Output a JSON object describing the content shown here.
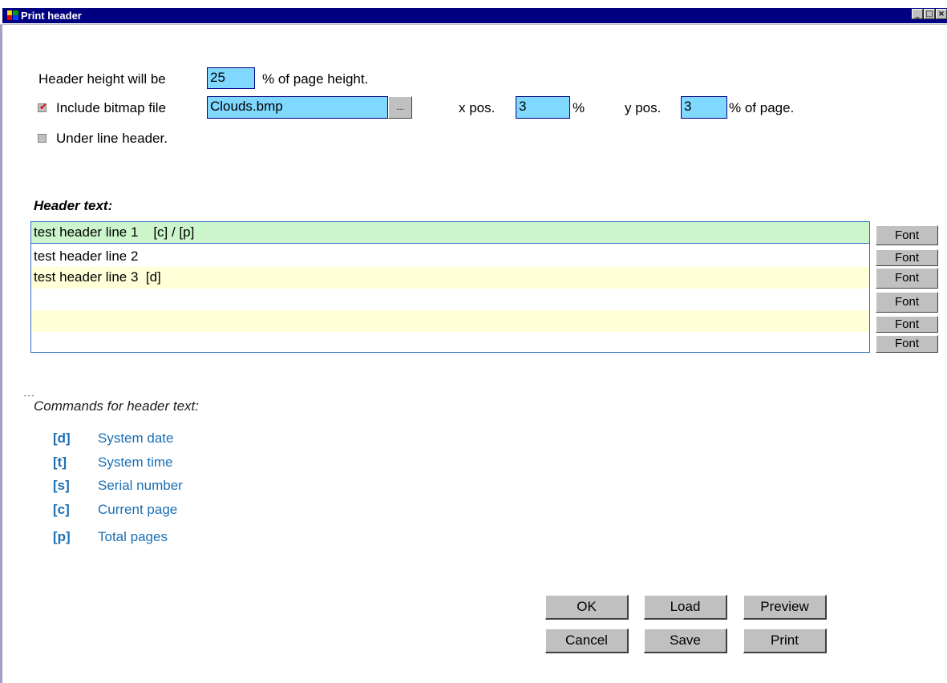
{
  "window": {
    "title": "Print header",
    "controls": {
      "minimize": "_",
      "maximize": "□",
      "close": "×"
    }
  },
  "header_height": {
    "label": "Header height will be",
    "value": "25",
    "suffix": "% of page height."
  },
  "bitmap": {
    "checked": true,
    "label": "Include bitmap file",
    "file": "Clouds.bmp",
    "browse_label": "...",
    "x_label": "x pos.",
    "x_value": "3",
    "x_suffix": "%",
    "y_label": "y pos.",
    "y_value": "3",
    "y_suffix": "% of page."
  },
  "underline": {
    "checked": false,
    "label": "Under line header."
  },
  "header_text": {
    "title": "Header text:",
    "lines": [
      "test header line 1    [c] / [p]",
      "test header line 2",
      "test header line 3  [d]",
      "",
      "",
      ""
    ],
    "font_button_label": "Font"
  },
  "commands": {
    "title": "Commands for header text:",
    "items": [
      {
        "key": "[d]",
        "desc": "System date"
      },
      {
        "key": "[t]",
        "desc": "System time"
      },
      {
        "key": "[s]",
        "desc": "Serial number"
      },
      {
        "key": "[c]",
        "desc": "Current page"
      },
      {
        "key": "[p]",
        "desc": "Total pages"
      }
    ]
  },
  "buttons": {
    "ok": "OK",
    "load": "Load",
    "preview": "Preview",
    "cancel": "Cancel",
    "save": "Save",
    "print": "Print"
  },
  "colors": {
    "title_bar": "#000080",
    "field_bg": "#80d8ff",
    "row_selected": "#ccf5cc",
    "row_alt": "#ffffd8",
    "command_text": "#1a6fb5"
  }
}
